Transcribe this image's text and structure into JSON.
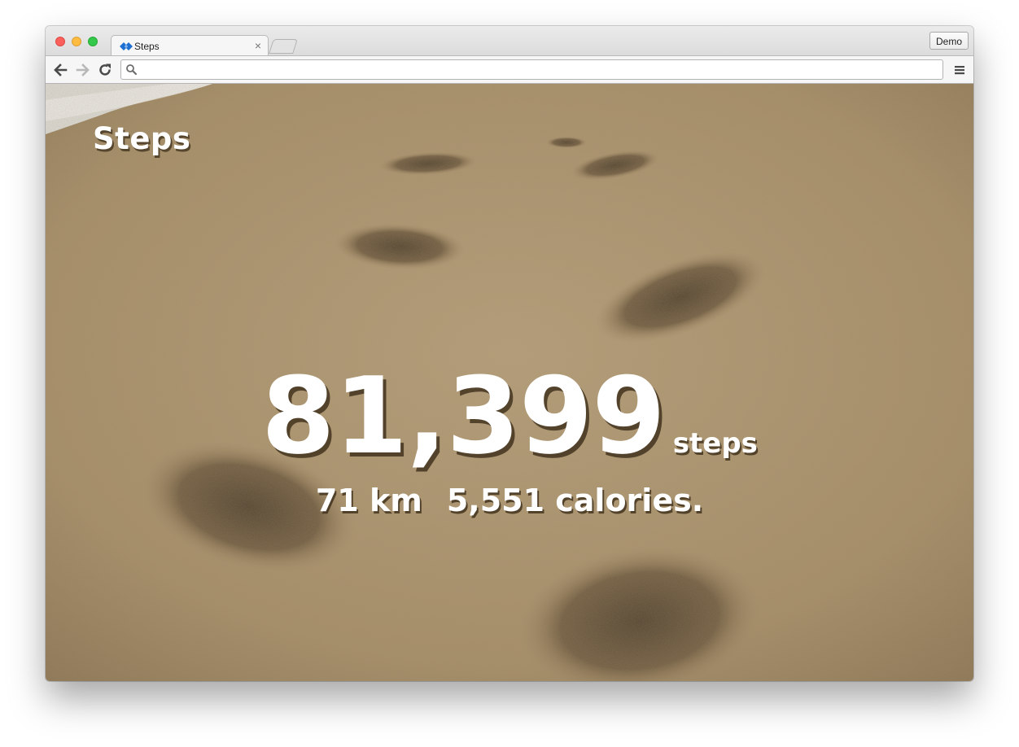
{
  "browser": {
    "tab": {
      "title": "Steps",
      "close_glyph": "×",
      "favicon": "app-logo-icon"
    },
    "profile_button": "Demo",
    "address_bar": {
      "value": "",
      "placeholder": ""
    }
  },
  "page": {
    "title": "Steps",
    "steps": {
      "value": "81,399",
      "unit": "steps"
    },
    "distance": "71 km",
    "calories": "5,551 calories."
  },
  "colors": {
    "favicon_blue": "#1e6fd2",
    "text": "#ffffff",
    "sand": "#b19a73"
  }
}
